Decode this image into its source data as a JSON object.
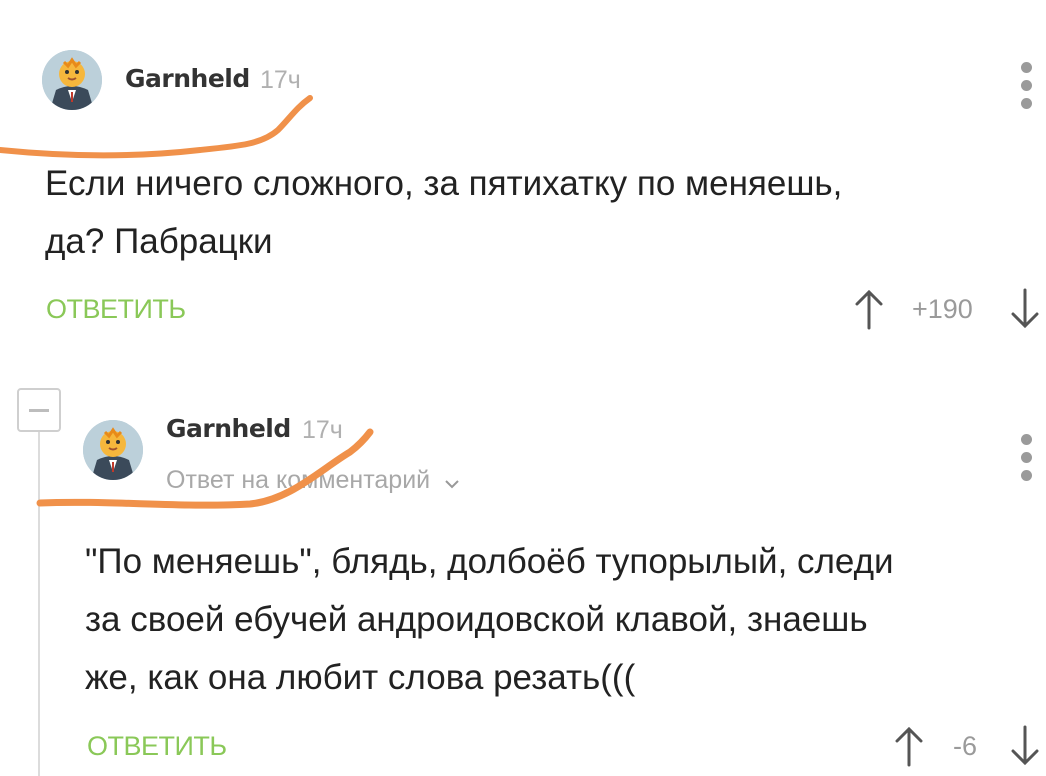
{
  "comments": [
    {
      "author": "Garnheld",
      "time": "17ч",
      "text_line1": "Если ничего сложного, за пятихатку по меняешь,",
      "text_line2": "да? Пабрацки",
      "reply_label": "ОТВЕТИТЬ",
      "rating": "+190"
    },
    {
      "author": "Garnheld",
      "time": "17ч",
      "reply_to": "Ответ на комментарий",
      "text_line1": "\"По меняешь\", блядь, долбоёб тупорылый, следи",
      "text_line2": "за своей ебучей андроидовской клавой, знаешь",
      "text_line3": "же, как она любит слова резать(((",
      "reply_label": "ОТВЕТИТЬ",
      "rating": "-6"
    }
  ],
  "icons": {
    "upvote": "arrow-up-icon",
    "downvote": "arrow-down-icon",
    "menu": "more-vertical-icon",
    "collapse": "minus-icon",
    "expand": "chevron-down-icon"
  },
  "colors": {
    "accent": "#8ac858",
    "annotation": "#f0914a"
  }
}
